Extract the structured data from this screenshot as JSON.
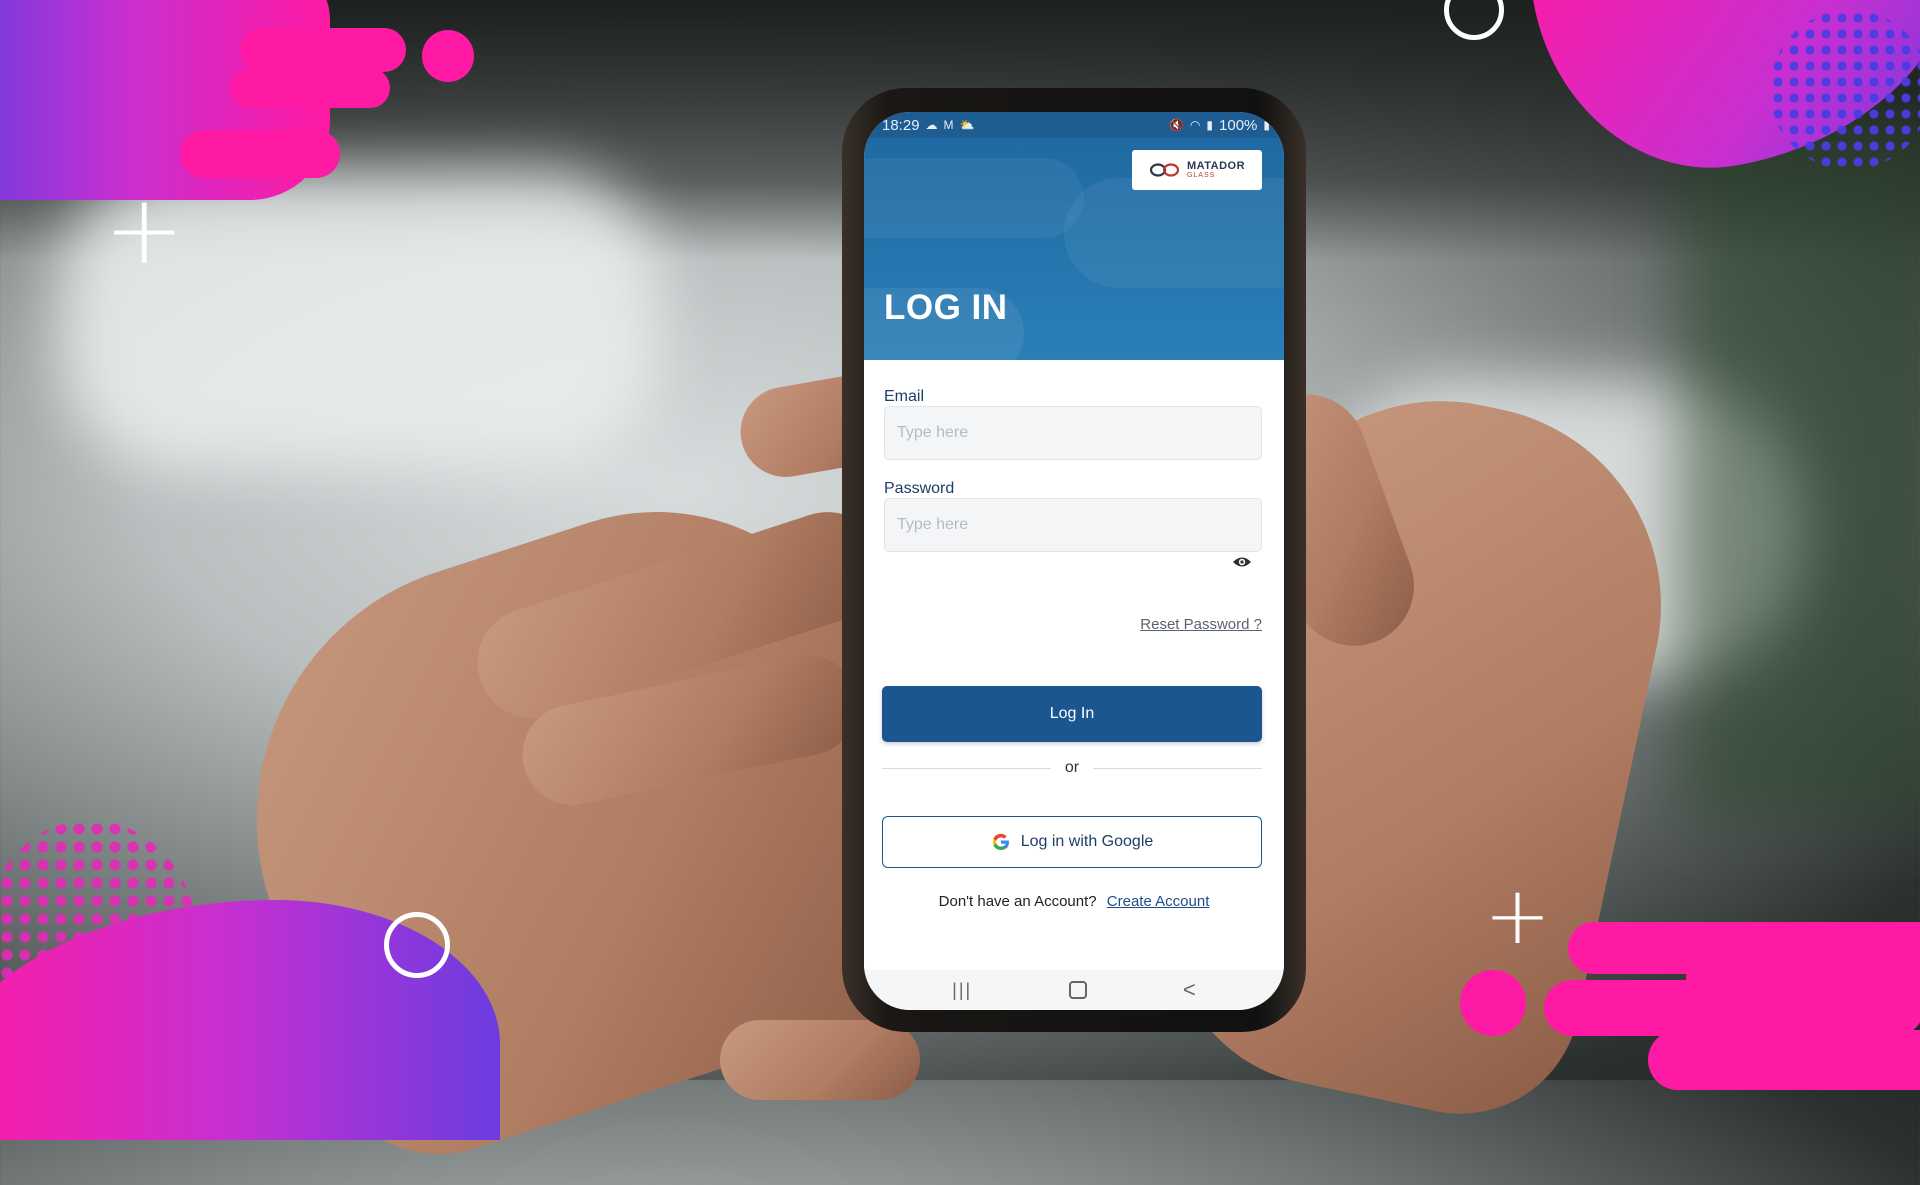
{
  "status_bar": {
    "time": "18:29",
    "left_icons": [
      "cloud-icon",
      "gmail-icon",
      "weather-icon"
    ],
    "right_icons": [
      "mute-icon",
      "wifi-icon",
      "signal-icon",
      "battery-icon"
    ],
    "battery": "100%"
  },
  "header": {
    "logo_name": "MATADOR",
    "logo_sub": "GLASS",
    "title": "LOG IN"
  },
  "form": {
    "email_label": "Email",
    "email_placeholder": "Type here",
    "password_label": "Password",
    "password_placeholder": "Type here",
    "reset_link": "Reset Password ?",
    "login_button": "Log In",
    "or_text": "or",
    "google_button": "Log in with Google",
    "signup_prompt": "Don't have an Account?",
    "create_account": "Create Account"
  },
  "nav_bar": {
    "recent": "|||",
    "back": "<"
  },
  "colors": {
    "header_blue": "#2377b0",
    "primary_button": "#1c5690",
    "accent_pink": "#ff1aa3",
    "accent_purple": "#6b3ce0"
  }
}
